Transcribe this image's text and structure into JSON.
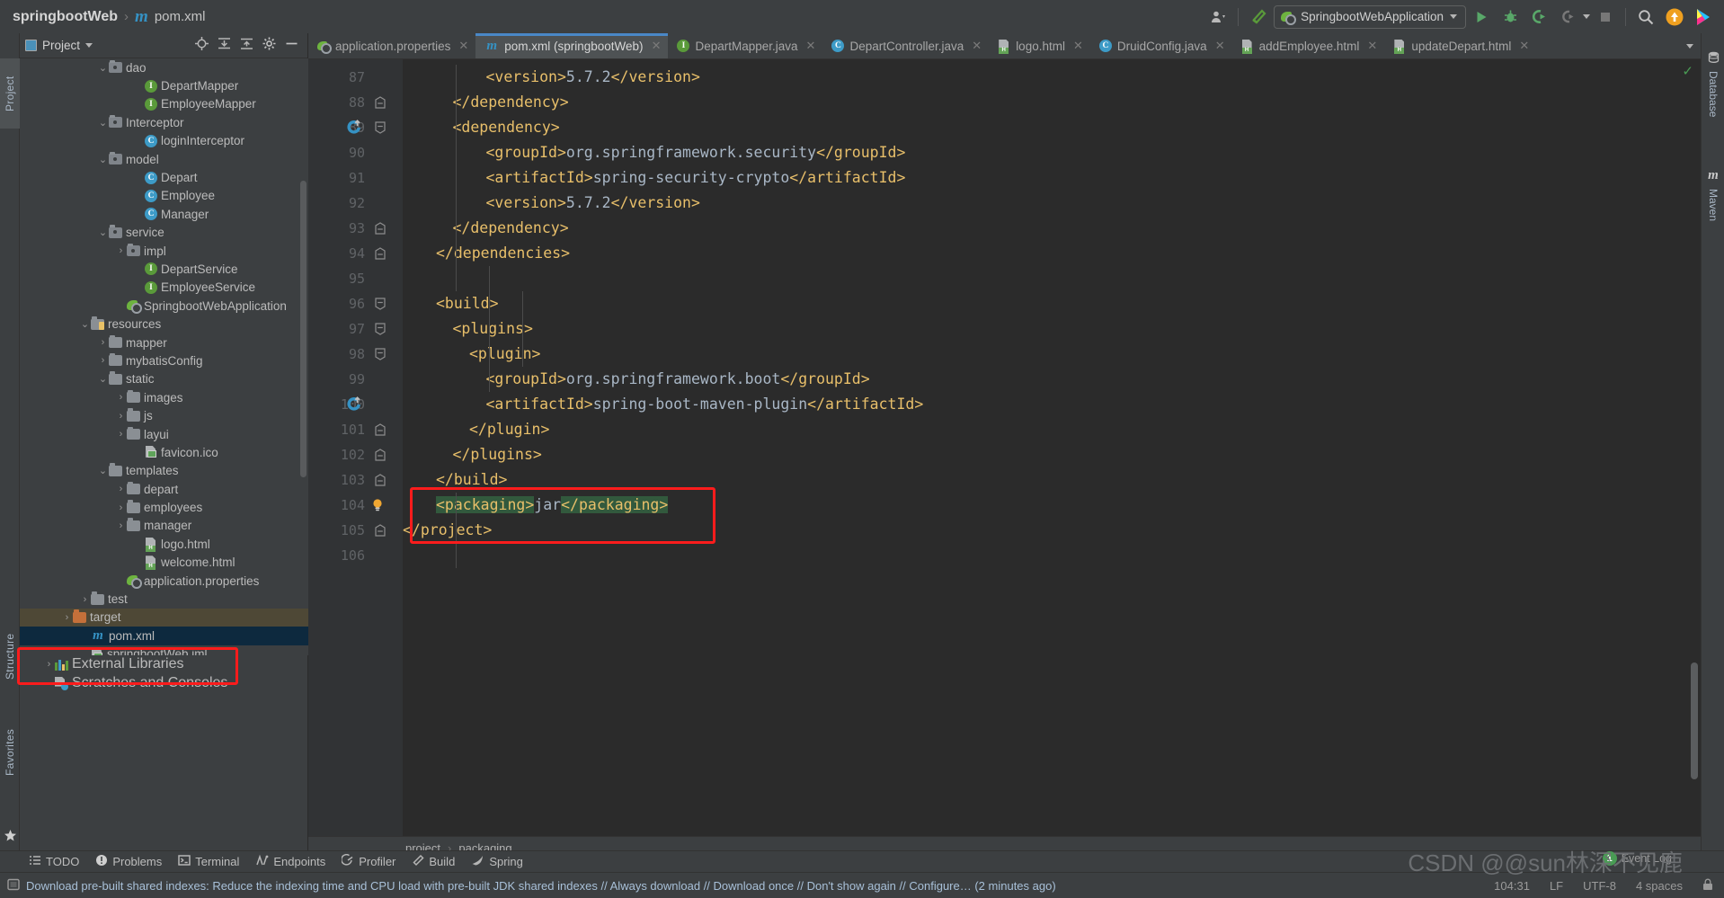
{
  "window": {
    "breadcrumb_project": "springbootWeb",
    "breadcrumb_sep": "›",
    "breadcrumb_file": "pom.xml",
    "maven_glyph": "m"
  },
  "toolbar": {
    "run_config": "SpringbootWebApplication",
    "icons": [
      "user-icon",
      "build-hammer-icon",
      "run-icon",
      "debug-icon",
      "run-coverage-icon",
      "profile-icon",
      "stop-icon",
      "search-icon",
      "update-icon",
      "ide-icon"
    ]
  },
  "left_strip": {
    "project": "Project",
    "structure": "Structure",
    "favorites": "Favorites"
  },
  "right_strip": {
    "database": "Database",
    "maven": "Maven",
    "maven_glyph": "m"
  },
  "project_panel": {
    "title": "Project",
    "tree": [
      {
        "label": "dao",
        "indent": 4,
        "arrow": "⌄",
        "icon": "folder-src",
        "type": "folder"
      },
      {
        "label": "DepartMapper",
        "indent": 6,
        "arrow": "",
        "icon": "interface",
        "type": "interface"
      },
      {
        "label": "EmployeeMapper",
        "indent": 6,
        "arrow": "",
        "icon": "interface",
        "type": "interface"
      },
      {
        "label": "Interceptor",
        "indent": 4,
        "arrow": "⌄",
        "icon": "folder-src",
        "type": "folder"
      },
      {
        "label": "loginInterceptor",
        "indent": 6,
        "arrow": "",
        "icon": "class",
        "type": "class"
      },
      {
        "label": "model",
        "indent": 4,
        "arrow": "⌄",
        "icon": "folder-src",
        "type": "folder"
      },
      {
        "label": "Depart",
        "indent": 6,
        "arrow": "",
        "icon": "class",
        "type": "class"
      },
      {
        "label": "Employee",
        "indent": 6,
        "arrow": "",
        "icon": "class",
        "type": "class"
      },
      {
        "label": "Manager",
        "indent": 6,
        "arrow": "",
        "icon": "class",
        "type": "class"
      },
      {
        "label": "service",
        "indent": 4,
        "arrow": "⌄",
        "icon": "folder-src",
        "type": "folder"
      },
      {
        "label": "impl",
        "indent": 5,
        "arrow": "›",
        "icon": "folder-src",
        "type": "folder"
      },
      {
        "label": "DepartService",
        "indent": 6,
        "arrow": "",
        "icon": "interface",
        "type": "interface"
      },
      {
        "label": "EmployeeService",
        "indent": 6,
        "arrow": "",
        "icon": "interface",
        "type": "interface"
      },
      {
        "label": "SpringbootWebApplication",
        "indent": 5,
        "arrow": "",
        "icon": "spring-run",
        "type": "spring"
      },
      {
        "label": "resources",
        "indent": 3,
        "arrow": "⌄",
        "icon": "folder-res",
        "type": "folder"
      },
      {
        "label": "mapper",
        "indent": 4,
        "arrow": "›",
        "icon": "folder",
        "type": "folder"
      },
      {
        "label": "mybatisConfig",
        "indent": 4,
        "arrow": "›",
        "icon": "folder",
        "type": "folder"
      },
      {
        "label": "static",
        "indent": 4,
        "arrow": "⌄",
        "icon": "folder",
        "type": "folder"
      },
      {
        "label": "images",
        "indent": 5,
        "arrow": "›",
        "icon": "folder",
        "type": "folder"
      },
      {
        "label": "js",
        "indent": 5,
        "arrow": "›",
        "icon": "folder",
        "type": "folder"
      },
      {
        "label": "layui",
        "indent": 5,
        "arrow": "›",
        "icon": "folder",
        "type": "folder"
      },
      {
        "label": "favicon.ico",
        "indent": 6,
        "arrow": "",
        "icon": "image-file",
        "type": "file"
      },
      {
        "label": "templates",
        "indent": 4,
        "arrow": "⌄",
        "icon": "folder",
        "type": "folder"
      },
      {
        "label": "depart",
        "indent": 5,
        "arrow": "›",
        "icon": "folder",
        "type": "folder"
      },
      {
        "label": "employees",
        "indent": 5,
        "arrow": "›",
        "icon": "folder",
        "type": "folder"
      },
      {
        "label": "manager",
        "indent": 5,
        "arrow": "›",
        "icon": "folder",
        "type": "folder"
      },
      {
        "label": "logo.html",
        "indent": 6,
        "arrow": "",
        "icon": "html-file",
        "type": "file"
      },
      {
        "label": "welcome.html",
        "indent": 6,
        "arrow": "",
        "icon": "html-file",
        "type": "file"
      },
      {
        "label": "application.properties",
        "indent": 5,
        "arrow": "",
        "icon": "spring-props",
        "type": "file"
      },
      {
        "label": "test",
        "indent": 3,
        "arrow": "›",
        "icon": "folder",
        "type": "folder"
      },
      {
        "label": "target",
        "indent": 2,
        "arrow": "›",
        "icon": "folder-orange",
        "type": "folder",
        "state": "target-hl"
      },
      {
        "label": "pom.xml",
        "indent": 3,
        "arrow": "",
        "icon": "maven-file",
        "type": "file",
        "state": "selected"
      },
      {
        "label": "springbootWeb.iml",
        "indent": 3,
        "arrow": "",
        "icon": "image-file",
        "type": "file"
      }
    ],
    "footer": [
      {
        "label": "External Libraries",
        "indent": 1,
        "arrow": "›",
        "icon": "libraries"
      },
      {
        "label": "Scratches and Consoles",
        "indent": 1,
        "arrow": "",
        "icon": "scratches"
      }
    ]
  },
  "editor": {
    "tabs": [
      {
        "label": "application.properties",
        "icon": "spring-props-icon",
        "active": false
      },
      {
        "label": "pom.xml (springbootWeb)",
        "icon": "maven-icon",
        "active": true
      },
      {
        "label": "DepartMapper.java",
        "icon": "interface-icon",
        "active": false
      },
      {
        "label": "DepartController.java",
        "icon": "class-icon",
        "active": false
      },
      {
        "label": "logo.html",
        "icon": "html-icon",
        "active": false
      },
      {
        "label": "DruidConfig.java",
        "icon": "class-icon",
        "active": false
      },
      {
        "label": "addEmployee.html",
        "icon": "html-icon",
        "active": false
      },
      {
        "label": "updateDepart.html",
        "icon": "html-icon",
        "active": false
      }
    ],
    "lines": [
      {
        "num": "87",
        "indent": 5,
        "segs": [
          {
            "t": "tag",
            "v": "<version>"
          },
          {
            "t": "txt",
            "v": "5.7.2"
          },
          {
            "t": "tag",
            "v": "</version>"
          }
        ],
        "fold": "",
        "mark": ""
      },
      {
        "num": "88",
        "indent": 3,
        "segs": [
          {
            "t": "tag",
            "v": "</dependency>"
          }
        ],
        "fold": "end",
        "mark": ""
      },
      {
        "num": "89",
        "indent": 3,
        "segs": [
          {
            "t": "tag",
            "v": "<dependency>"
          }
        ],
        "fold": "start",
        "mark": "update"
      },
      {
        "num": "90",
        "indent": 5,
        "segs": [
          {
            "t": "tag",
            "v": "<groupId>"
          },
          {
            "t": "txt",
            "v": "org.springframework.security"
          },
          {
            "t": "tag",
            "v": "</groupId>"
          }
        ],
        "fold": "",
        "mark": ""
      },
      {
        "num": "91",
        "indent": 5,
        "segs": [
          {
            "t": "tag",
            "v": "<artifactId>"
          },
          {
            "t": "txt",
            "v": "spring-security-crypto"
          },
          {
            "t": "tag",
            "v": "</artifactId>"
          }
        ],
        "fold": "",
        "mark": ""
      },
      {
        "num": "92",
        "indent": 5,
        "segs": [
          {
            "t": "tag",
            "v": "<version>"
          },
          {
            "t": "txt",
            "v": "5.7.2"
          },
          {
            "t": "tag",
            "v": "</version>"
          }
        ],
        "fold": "",
        "mark": ""
      },
      {
        "num": "93",
        "indent": 3,
        "segs": [
          {
            "t": "tag",
            "v": "</dependency>"
          }
        ],
        "fold": "end",
        "mark": ""
      },
      {
        "num": "94",
        "indent": 2,
        "segs": [
          {
            "t": "tag",
            "v": "</dependencies>"
          }
        ],
        "fold": "end",
        "mark": ""
      },
      {
        "num": "95",
        "indent": 0,
        "segs": [],
        "fold": "",
        "mark": ""
      },
      {
        "num": "96",
        "indent": 2,
        "segs": [
          {
            "t": "tag",
            "v": "<build>"
          }
        ],
        "fold": "start",
        "mark": ""
      },
      {
        "num": "97",
        "indent": 3,
        "segs": [
          {
            "t": "tag",
            "v": "<plugins>"
          }
        ],
        "fold": "start",
        "mark": ""
      },
      {
        "num": "98",
        "indent": 4,
        "segs": [
          {
            "t": "tag",
            "v": "<plugin>"
          }
        ],
        "fold": "start",
        "mark": ""
      },
      {
        "num": "99",
        "indent": 5,
        "segs": [
          {
            "t": "tag",
            "v": "<groupId>"
          },
          {
            "t": "txt",
            "v": "org.springframework.boot"
          },
          {
            "t": "tag",
            "v": "</groupId>"
          }
        ],
        "fold": "",
        "mark": ""
      },
      {
        "num": "100",
        "indent": 5,
        "segs": [
          {
            "t": "tag",
            "v": "<artifactId>"
          },
          {
            "t": "txt",
            "v": "spring-boot-maven-plugin"
          },
          {
            "t": "tag",
            "v": "</artifactId>"
          }
        ],
        "fold": "",
        "mark": "update"
      },
      {
        "num": "101",
        "indent": 4,
        "segs": [
          {
            "t": "tag",
            "v": "</plugin>"
          }
        ],
        "fold": "end",
        "mark": ""
      },
      {
        "num": "102",
        "indent": 3,
        "segs": [
          {
            "t": "tag",
            "v": "</plugins>"
          }
        ],
        "fold": "end",
        "mark": ""
      },
      {
        "num": "103",
        "indent": 2,
        "segs": [
          {
            "t": "tag",
            "v": "</build>"
          }
        ],
        "fold": "end",
        "mark": ""
      },
      {
        "num": "104",
        "indent": 2,
        "segs": [
          {
            "t": "tag hl",
            "v": "<packaging>"
          },
          {
            "t": "txt",
            "v": "jar"
          },
          {
            "t": "tag hl",
            "v": "</packaging>"
          }
        ],
        "fold": "",
        "mark": "bulb"
      },
      {
        "num": "105",
        "indent": 0,
        "segs": [
          {
            "t": "tag",
            "v": "</project>"
          }
        ],
        "fold": "end",
        "mark": ""
      },
      {
        "num": "106",
        "indent": 0,
        "segs": [],
        "fold": "",
        "mark": ""
      }
    ],
    "breadcrumb": [
      "project",
      "packaging"
    ],
    "breadcrumb_sep": "›"
  },
  "bottom_tools": [
    {
      "label": "TODO",
      "icon": "todo-icon"
    },
    {
      "label": "Problems",
      "icon": "problems-icon"
    },
    {
      "label": "Terminal",
      "icon": "terminal-icon"
    },
    {
      "label": "Endpoints",
      "icon": "endpoints-icon"
    },
    {
      "label": "Profiler",
      "icon": "profiler-icon"
    },
    {
      "label": "Build",
      "icon": "build-icon"
    },
    {
      "label": "Spring",
      "icon": "spring-icon"
    }
  ],
  "status": {
    "message": "Download pre-built shared indexes: Reduce the indexing time and CPU load with pre-built JDK shared indexes // Always download // Download once // Don't show again // Configure… (2 minutes ago)",
    "event_log": "Event Log",
    "event_count": "1",
    "caret": "104:31",
    "line_sep": "LF",
    "encoding": "UTF-8",
    "indent": "4 spaces"
  },
  "watermark": "CSDN @@sun林深不见鹿"
}
